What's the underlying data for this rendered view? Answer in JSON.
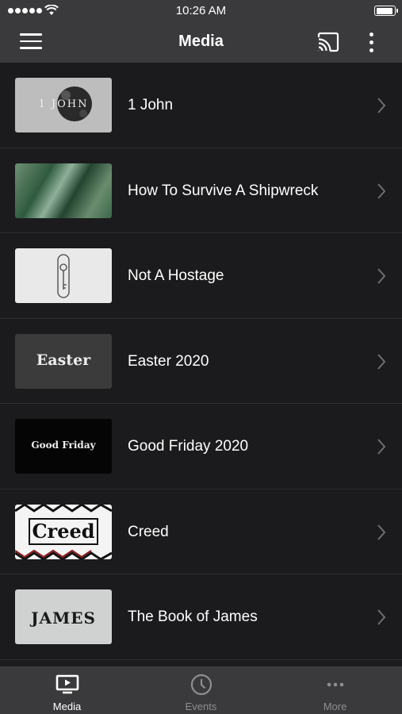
{
  "status_bar": {
    "time": "10:26 AM"
  },
  "nav": {
    "title": "Media"
  },
  "media_items": [
    {
      "title": "1 John",
      "thumb_text": "1 JOHN"
    },
    {
      "title": "How To Survive A Shipwreck",
      "thumb_text": ""
    },
    {
      "title": "Not A Hostage",
      "thumb_text": ""
    },
    {
      "title": "Easter 2020",
      "thumb_text": "Easter"
    },
    {
      "title": "Good Friday 2020",
      "thumb_text": "Good Friday"
    },
    {
      "title": "Creed",
      "thumb_text": "Creed"
    },
    {
      "title": "The Book of James",
      "thumb_text": "JAMES"
    }
  ],
  "tabs": [
    {
      "label": "Media",
      "icon": "tv-icon",
      "active": true
    },
    {
      "label": "Events",
      "icon": "clock-icon",
      "active": false
    },
    {
      "label": "More",
      "icon": "more-horizontal-icon",
      "active": false
    }
  ],
  "colors": {
    "background": "#1b1b1d",
    "bar": "#3a3a3c",
    "active_tab": "#ffffff",
    "inactive_tab": "#8e8e93",
    "chevron": "#6e6e73"
  }
}
